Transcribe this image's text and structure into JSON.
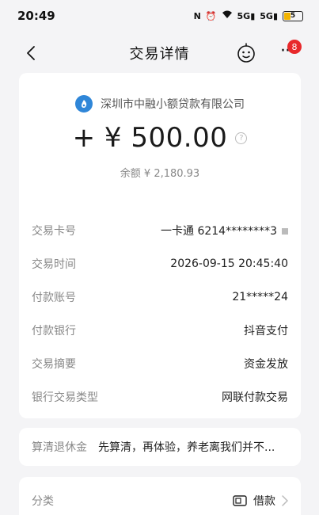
{
  "status_bar": {
    "time": "20:49",
    "signal1": "5G",
    "signal2": "5G",
    "battery": "5"
  },
  "nav": {
    "title": "交易详情",
    "notification_count": "8"
  },
  "transaction": {
    "company": "深圳市中融小额贷款有限公司",
    "amount": "+ ¥ 500.00",
    "balance": "余额 ¥ 2,180.93",
    "details": [
      {
        "label": "交易卡号",
        "value": "一卡通 6214********3"
      },
      {
        "label": "交易时间",
        "value": "2026-09-15 20:45:40"
      },
      {
        "label": "付款账号",
        "value": "21*****24"
      },
      {
        "label": "付款银行",
        "value": "抖音支付"
      },
      {
        "label": "交易摘要",
        "value": "资金发放"
      },
      {
        "label": "银行交易类型",
        "value": "网联付款交易"
      }
    ]
  },
  "note": {
    "label": "算清退休金",
    "text": "先算清，再体验，养老离我们并不..."
  },
  "category": {
    "label": "分类",
    "value": "借款"
  },
  "colors": {
    "accent_blue": "#2f86d8",
    "badge_red": "#e8282b",
    "background": "#f4f4f6"
  }
}
